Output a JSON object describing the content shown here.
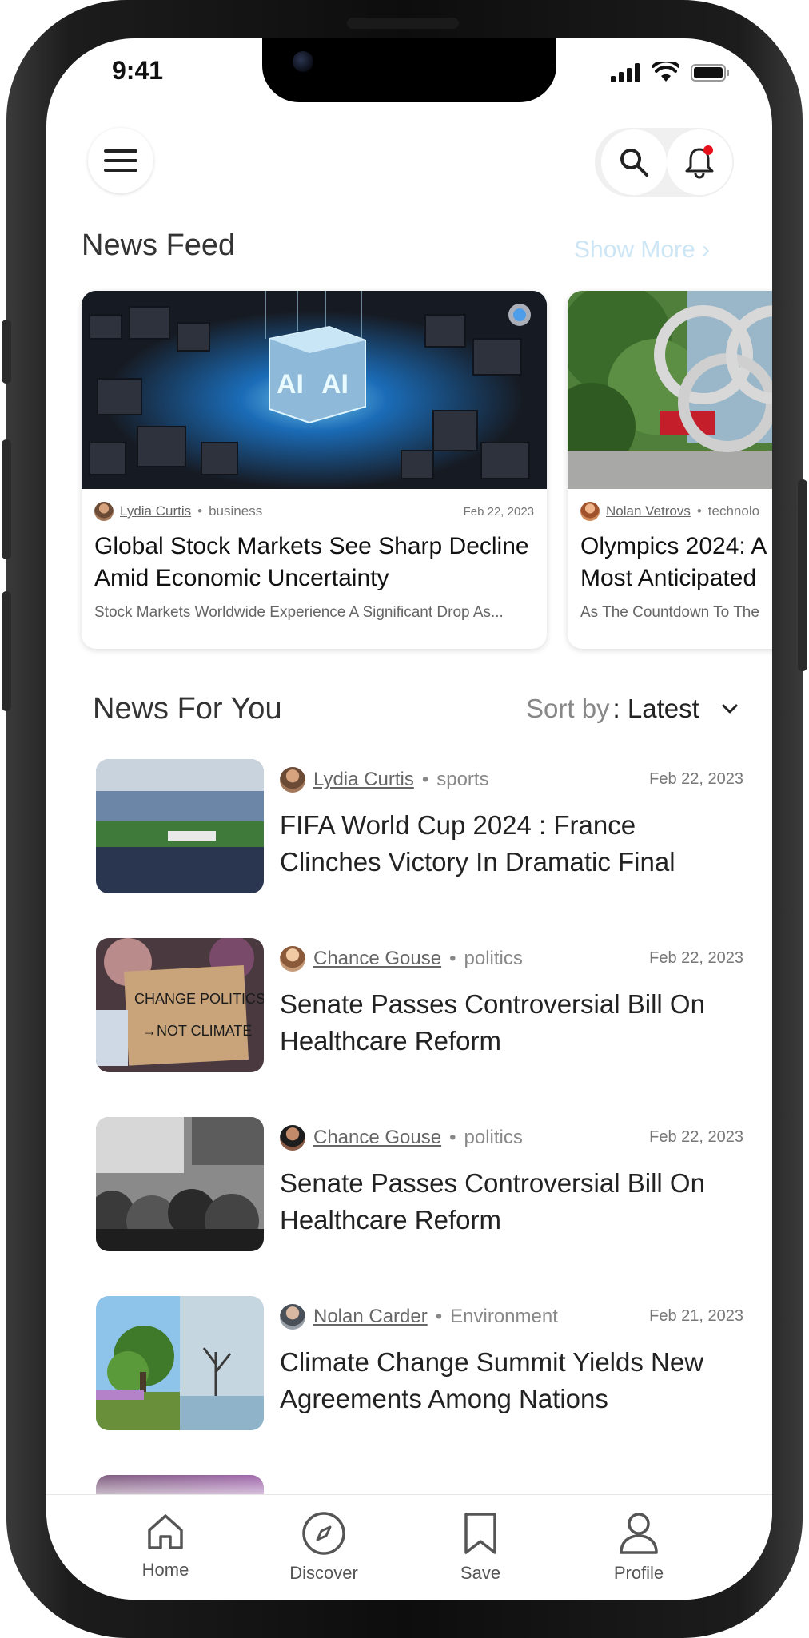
{
  "status": {
    "time": "9:41"
  },
  "featured": {
    "title": "News Feed",
    "show_more": "Show More",
    "cards": [
      {
        "author": "Lydia Curtis",
        "category": "business",
        "date": "Feb 22, 2023",
        "title": "Global Stock Markets See Sharp Decline Amid Economic Uncertainty",
        "excerpt": "Stock Markets Worldwide Experience A Significant Drop As...",
        "image": "ai-cube-image"
      },
      {
        "author": "Nolan Vetrovs",
        "category": "technolo",
        "date": "",
        "title": "Olympics 2024: A Most Anticipated",
        "excerpt": "As The Countdown To The",
        "image": "olympic-rings-image"
      }
    ]
  },
  "for_you": {
    "title": "News For You",
    "sort_label": "Sort by",
    "sort_value": ": Latest",
    "items": [
      {
        "author": "Lydia Curtis",
        "category": "sports",
        "date": "Feb 22, 2023",
        "title": "FIFA World Cup 2024 : France Clinches Victory In Dramatic Final"
      },
      {
        "author": "Chance Gouse",
        "category": "politics",
        "date": "Feb 22, 2023",
        "title": "Senate Passes Controversial Bill On Healthcare Reform"
      },
      {
        "author": "Chance Gouse",
        "category": "politics",
        "date": "Feb 22, 2023",
        "title": "Senate Passes Controversial Bill On Healthcare Reform"
      },
      {
        "author": "Nolan Carder",
        "category": "Environment",
        "date": "Feb 21, 2023",
        "title": "Climate Change Summit Yields New Agreements Among Nations"
      }
    ]
  },
  "tabs": [
    {
      "label": "Home",
      "icon": "home-icon"
    },
    {
      "label": "Discover",
      "icon": "compass-icon"
    },
    {
      "label": "Save",
      "icon": "bookmark-icon"
    },
    {
      "label": "Profile",
      "icon": "user-icon"
    }
  ],
  "colors": {
    "accent": "#cde6f6",
    "notification": "#e8101b"
  }
}
